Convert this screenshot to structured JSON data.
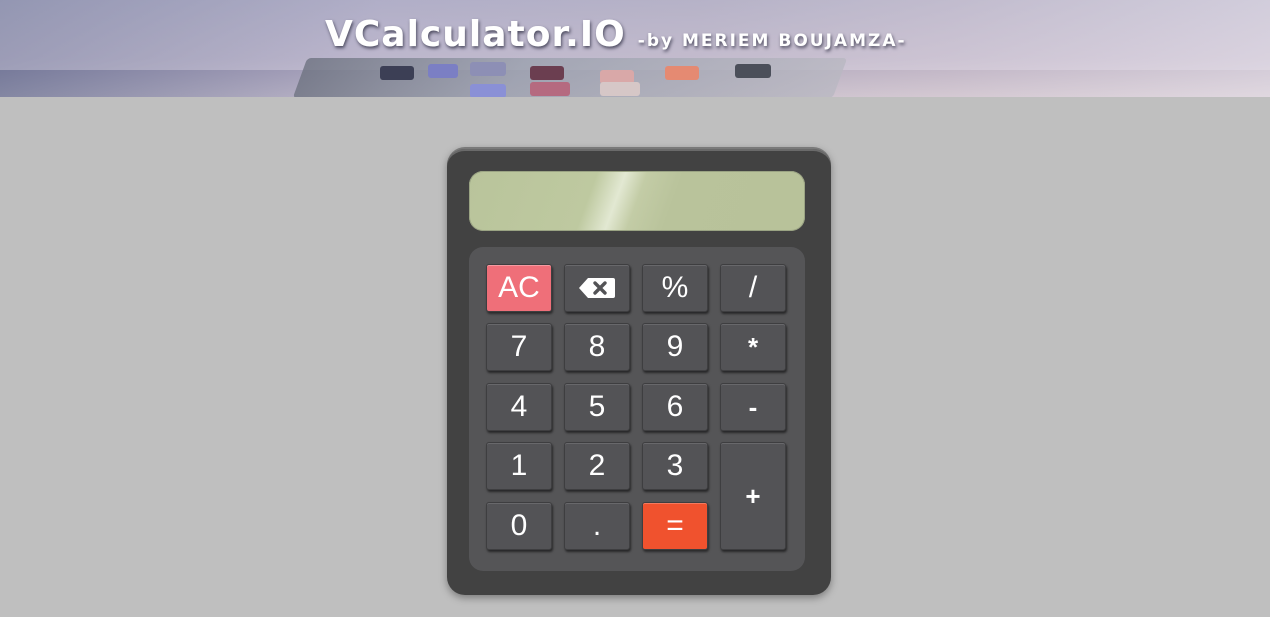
{
  "header": {
    "title": "VCalculator.IO",
    "byline": "-by MERIEM BOUJAMZA-"
  },
  "display": {
    "value": ""
  },
  "keys": {
    "ac": "AC",
    "backspace_icon": "backspace-icon",
    "percent": "%",
    "divide": "/",
    "seven": "7",
    "eight": "8",
    "nine": "9",
    "multiply": "*",
    "four": "4",
    "five": "5",
    "six": "6",
    "minus": "-",
    "one": "1",
    "two": "2",
    "three": "3",
    "plus": "+",
    "zero": "0",
    "dot": ".",
    "equals": "="
  },
  "colors": {
    "page_background": "#bfbfbf",
    "calculator_body": "#424242",
    "keypad": "#555557",
    "key": "#535356",
    "ac_key": "#ef6f79",
    "equals_key": "#f0522e",
    "screen": "#bec9a0"
  }
}
